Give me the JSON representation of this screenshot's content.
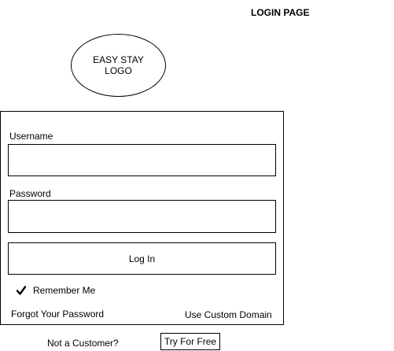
{
  "header": {
    "title": "LOGIN PAGE"
  },
  "logo": {
    "line1": "EASY STAY",
    "line2": "LOGO"
  },
  "form": {
    "username_label": "Username",
    "username_value": "",
    "password_label": "Password",
    "password_value": "",
    "login_label": "Log In",
    "remember_label": "Remember Me",
    "remember_checked": true,
    "forgot_label": "Forgot Your Password",
    "custom_domain_label": "Use Custom Domain"
  },
  "footer": {
    "prompt": "Not a Customer?",
    "trial_label": "Try For Free"
  },
  "icons": {
    "remember": "check-icon"
  }
}
